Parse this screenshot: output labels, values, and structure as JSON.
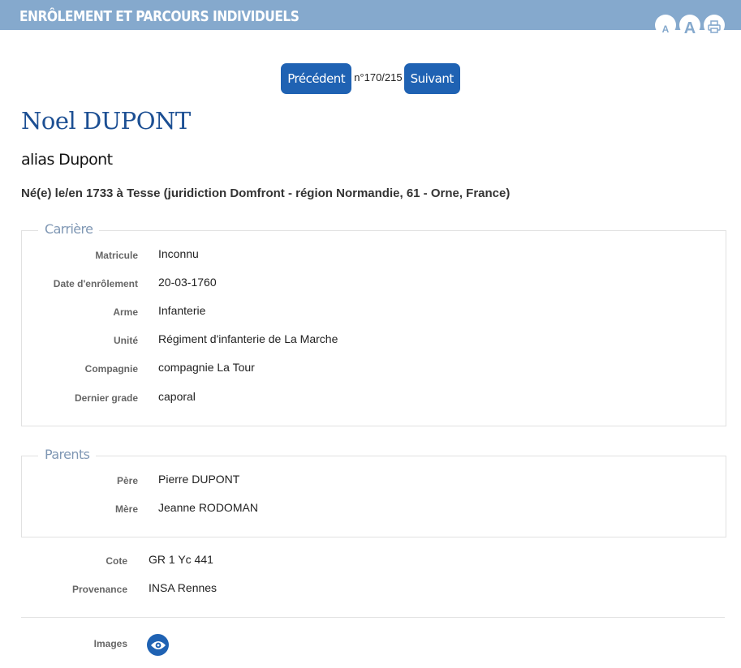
{
  "header": {
    "title": "Enrôlement et parcours individuels",
    "font_small": "A",
    "font_large": "A",
    "print_icon": "print-icon"
  },
  "nav": {
    "prev_label": "Précédent",
    "counter": "n°170/215",
    "next_label": "Suivant"
  },
  "person": {
    "name": "Noel DUPONT",
    "alias": "alias Dupont",
    "birth": "Né(e) le/en 1733 à Tesse (juridiction Domfront - région Normandie, 61 - Orne, France)"
  },
  "career": {
    "legend": "Carrière",
    "rows": [
      {
        "label": "Matricule",
        "value": "Inconnu"
      },
      {
        "label": "Date d'enrôlement",
        "value": "20-03-1760"
      },
      {
        "label": "Arme",
        "value": "Infanterie"
      },
      {
        "label": "Unité",
        "value": "Régiment d'infanterie de La Marche"
      },
      {
        "label": "Compagnie",
        "value": "compagnie La Tour"
      },
      {
        "label": "Dernier grade",
        "value": "caporal"
      }
    ]
  },
  "parents": {
    "legend": "Parents",
    "rows": [
      {
        "label": "Père",
        "value": "Pierre DUPONT"
      },
      {
        "label": "Mère",
        "value": "Jeanne RODOMAN"
      }
    ]
  },
  "meta": {
    "rows": [
      {
        "label": "Cote",
        "value": "GR 1 Yc 441"
      },
      {
        "label": "Provenance",
        "value": "INSA Rennes"
      }
    ]
  },
  "images": {
    "label": "Images",
    "icon": "eye-icon"
  },
  "colors": {
    "header_bg": "#85a9cd",
    "accent": "#1f62b3",
    "name": "#1c4f93",
    "legend": "#7f97b4"
  }
}
